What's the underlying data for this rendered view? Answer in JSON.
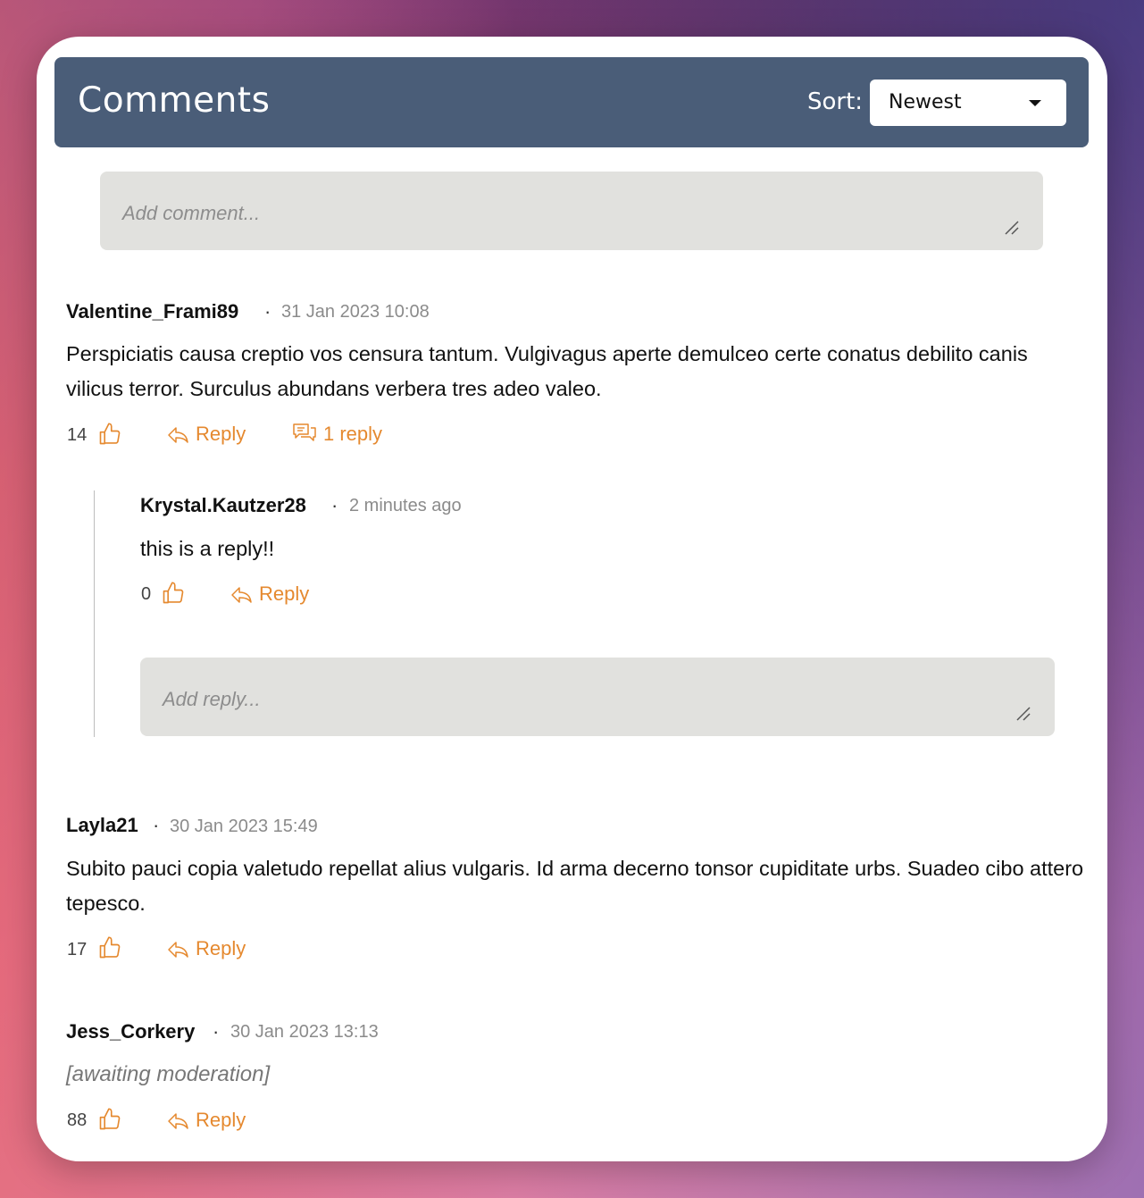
{
  "header": {
    "title": "Comments",
    "sort_label": "Sort:",
    "sort_value": "Newest"
  },
  "new_comment": {
    "placeholder": "Add comment..."
  },
  "comments": [
    {
      "author": "Valentine_Frami89",
      "date": "31 Jan 2023 10:08",
      "body": "Perspiciatis causa creptio vos censura tantum. Vulgivagus aperte demulceo certe conatus debilito canis vilicus terror. Surculus abundans verbera tres adeo valeo.",
      "likes": "14",
      "reply_label": "Reply",
      "replies_label": "1 reply",
      "replies": [
        {
          "author": "Krystal.Kautzer28",
          "date": "2 minutes ago",
          "body": "this is a reply!!",
          "likes": "0",
          "reply_label": "Reply"
        }
      ],
      "reply_placeholder": "Add reply..."
    },
    {
      "author": "Layla21",
      "date": "30 Jan 2023 15:49",
      "body": "Subito pauci copia valetudo repellat alius vulgaris. Id arma decerno tonsor cupiditate urbs. Suadeo cibo attero tepesco.",
      "likes": "17",
      "reply_label": "Reply"
    },
    {
      "author": "Jess_Corkery",
      "date": "30 Jan 2023 13:13",
      "body": "[awaiting moderation]",
      "likes": "88",
      "reply_label": "Reply"
    }
  ],
  "colors": {
    "header_bg": "#4a5d78",
    "accent": "#e5892f",
    "input_bg": "#e1e1de"
  },
  "icons": {
    "like": "thumbs-up-icon",
    "reply": "reply-arrow-icon",
    "replies": "chat-bubbles-icon",
    "resize": "resize-handle-icon",
    "dropdown": "caret-down-icon"
  }
}
